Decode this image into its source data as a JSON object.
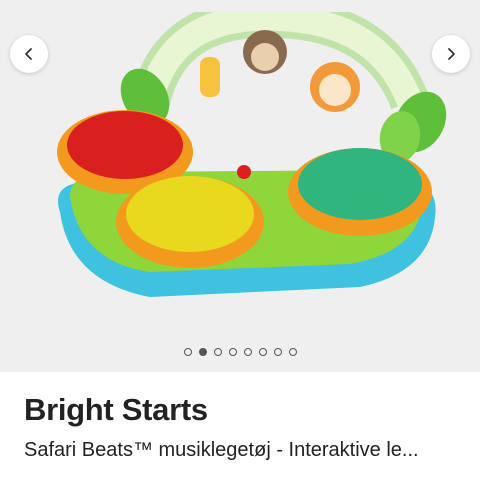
{
  "gallery": {
    "image_alt": "Bright Starts Safari Beats musical drum toy",
    "prev_icon": "chevron-left-icon",
    "next_icon": "chevron-right-icon",
    "slide_count": 8,
    "active_slide": 2
  },
  "product": {
    "brand": "Bright Starts",
    "name": "Safari Beats™ musiklegetøj - Interaktive le..."
  }
}
